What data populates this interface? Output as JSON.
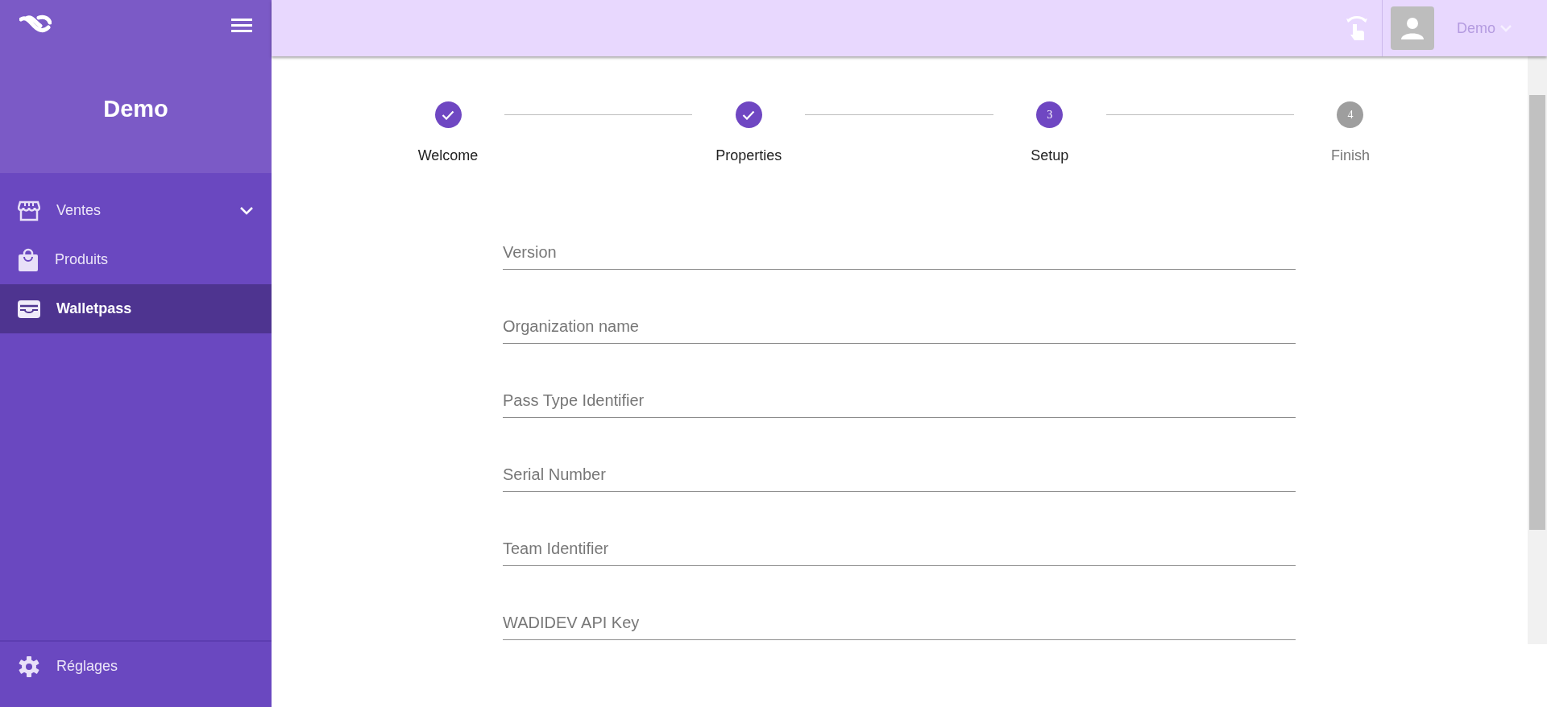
{
  "sidebar": {
    "title": "Demo",
    "items": [
      {
        "label": "Ventes",
        "expandable": true,
        "selected": false
      },
      {
        "label": "Produits",
        "expandable": false,
        "selected": false
      },
      {
        "label": "Walletpass",
        "expandable": false,
        "selected": true
      }
    ],
    "footer_item": {
      "label": "Réglages"
    }
  },
  "header": {
    "user": "Demo"
  },
  "stepper": [
    {
      "label": "Welcome",
      "kind": "done"
    },
    {
      "label": "Properties",
      "kind": "done"
    },
    {
      "label": "Setup",
      "kind": "active",
      "number": "3"
    },
    {
      "label": "Finish",
      "kind": "pending",
      "number": "4"
    }
  ],
  "fields": [
    {
      "placeholder": "Version"
    },
    {
      "placeholder": "Organization name"
    },
    {
      "placeholder": "Pass Type Identifier"
    },
    {
      "placeholder": "Serial Number"
    },
    {
      "placeholder": "Team Identifier"
    },
    {
      "placeholder": "WADIDEV API Key"
    }
  ]
}
